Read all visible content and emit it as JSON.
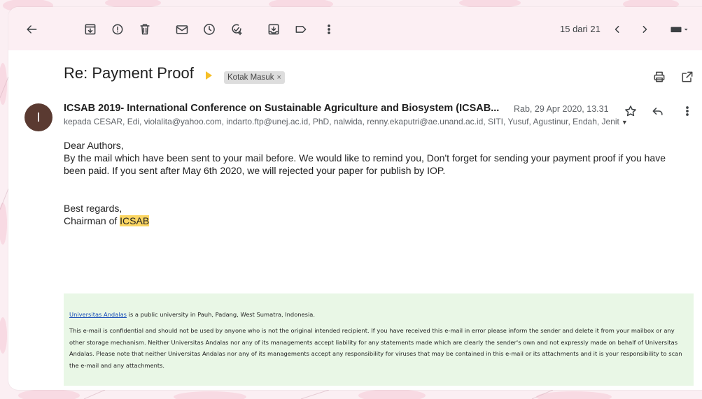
{
  "toolbar": {
    "icons": [
      "back-arrow-icon",
      "archive-icon",
      "report-spam-icon",
      "delete-icon",
      "mark-unread-icon",
      "snooze-icon",
      "add-task-icon",
      "move-to-icon",
      "label-icon",
      "more-vert-icon",
      "newer-chevron-icon",
      "older-chevron-icon",
      "input-tools-icon"
    ],
    "pager_text": "15 dari 21"
  },
  "email": {
    "subject": "Re: Payment Proof",
    "label": "Kotak Masuk",
    "label_close": "×",
    "sender": "ICSAB 2019- International Conference on Sustainable Agriculture and Biosystem (ICSAB...",
    "avatar_letter": "I",
    "date": "Rab, 29 Apr 2020, 13.31",
    "recipients": "kepada CESAR, Edi, violalita@yahoo.com, indarto.ftp@unej.ac.id, PhD, nalwida, renny.ekaputri@ae.unand.ac.id, SITI, Yusuf, Agustinur, Endah, Jenit",
    "body": {
      "greeting": "Dear Authors,",
      "paragraph": "By the mail which have been sent to your mail before. We would like to remind you, Don't forget for sending your payment proof if you have been paid. If you sent after May 6th 2020, we will rejected your paper for publish by IOP.",
      "closing": "Best regards,",
      "signature_prefix": "Chairman of ",
      "signature_highlight": "ICSAB"
    },
    "footer": {
      "link_text": "Universitas Andalas",
      "line1_rest": " is a public university in Pauh, Padang, West Sumatra, Indonesia.",
      "disclaimer": "This e-mail is confidential and should not be used by anyone who is not the original intended recipient. If you have received this e-mail in error please inform the sender and delete it from your mailbox or any other storage mechanism. Neither Universitas Andalas nor any of its managements accept liability for any statements made which are clearly the sender's own and not expressly made on behalf of Universitas Andalas. Please note that neither Universitas Andalas nor any of its managements accept any responsibility for viruses that may be contained in this e-mail or its attachments and it is your responsibility to scan the e-mail and any attachments."
    }
  },
  "colors": {
    "avatar_bg": "#5a3a31",
    "label_arrow": "#f6bf26",
    "highlight": "#fcd663",
    "footer_bg": "#e9f7e6",
    "theme_bg": "#fbeff3"
  }
}
